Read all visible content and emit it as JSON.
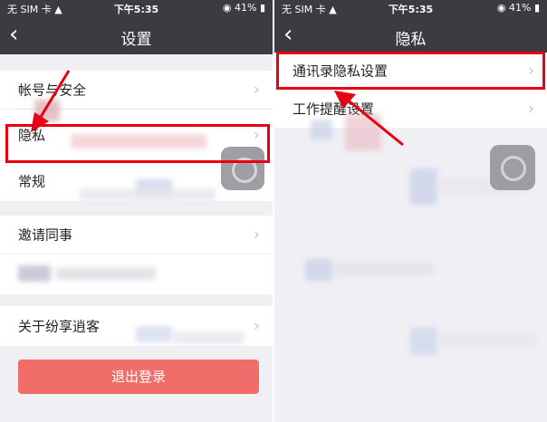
{
  "status_bar": {
    "carrier": "无 SIM 卡",
    "time": "下午5:35",
    "battery": "41%",
    "wifi_icon": "wifi-icon",
    "lock_icon": "rotation-lock-icon"
  },
  "left": {
    "back_icon": "back-chevron-icon",
    "title": "设置",
    "items": [
      {
        "label": "帐号与安全"
      },
      {
        "label": "隐私"
      },
      {
        "label": "常规"
      },
      {
        "label": "邀请同事"
      },
      {
        "label": "关于纷享逍客"
      }
    ],
    "logout_label": "退出登录"
  },
  "right": {
    "back_icon": "back-chevron-icon",
    "title": "隐私",
    "items": [
      {
        "label": "通讯录隐私设置"
      },
      {
        "label": "工作提醒设置"
      }
    ]
  },
  "colors": {
    "nav_bg": "#3b3b40",
    "highlight": "#e60012",
    "logout_bg": "#f16d6a",
    "page_bg": "#efeff4"
  }
}
